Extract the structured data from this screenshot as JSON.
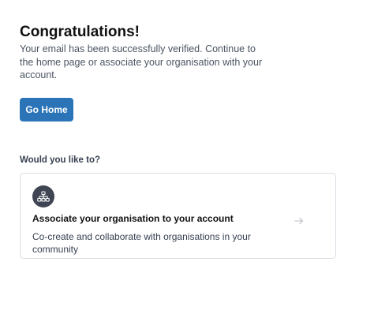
{
  "header": {
    "title": "Congratulations!",
    "message": "Your email has been successfully verified. Continue to the home page or associate your organisation with your account."
  },
  "actions": {
    "go_home_label": "Go Home"
  },
  "options_section": {
    "label": "Would you like to?",
    "cards": [
      {
        "icon": "organisation-hierarchy-icon",
        "title": "Associate your organisation to your account",
        "description": "Co-create and collaborate with organisations in your community",
        "arrow_icon": "arrow-right-icon"
      }
    ]
  },
  "colors": {
    "primary_button": "#2b74b8",
    "icon_circle": "#3f4552",
    "card_border": "#d9dde3"
  }
}
